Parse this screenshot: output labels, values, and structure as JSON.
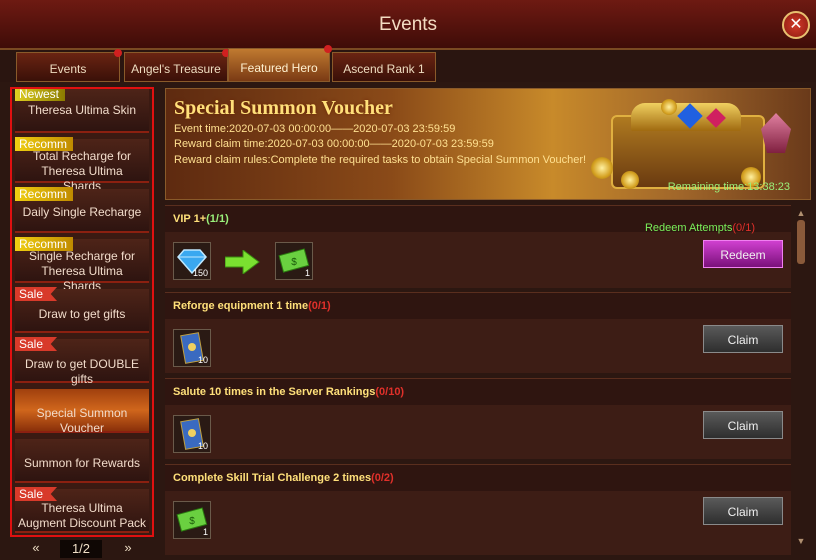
{
  "window": {
    "title": "Events"
  },
  "tabs": [
    {
      "label": "Events",
      "active": false
    },
    {
      "label": "Angel's Treasure",
      "active": false
    },
    {
      "label": "Featured Hero",
      "active": true
    },
    {
      "label": "Ascend Rank 1",
      "active": false
    }
  ],
  "sidebar": {
    "items": [
      {
        "badge": "Newest",
        "label": "Theresa Ultima Skin"
      },
      {
        "badge": "Recomm",
        "label": "Total Recharge for Theresa Ultima Shards"
      },
      {
        "badge": "Recomm",
        "label": "Daily Single Recharge"
      },
      {
        "badge": "Recomm",
        "label": "Single Recharge for Theresa Ultima Shards"
      },
      {
        "badge": "Sale",
        "label": "Draw to get gifts"
      },
      {
        "badge": "Sale",
        "label": "Draw to get DOUBLE gifts"
      },
      {
        "badge": "",
        "label": "Special Summon Voucher",
        "active": true
      },
      {
        "badge": "",
        "label": "Summon for Rewards"
      },
      {
        "badge": "Sale",
        "label": "Theresa Ultima Augment Discount Pack"
      }
    ]
  },
  "pager": {
    "prev": "«",
    "page": "1/2",
    "next": "»"
  },
  "banner": {
    "title": "Special Summon Voucher",
    "event_time": "Event time:2020-07-03 00:00:00——2020-07-03 23:59:59",
    "claim_time": "Reward claim time:2020-07-03 00:00:00——2020-07-03 23:59:59",
    "rules": "Reward claim rules:Complete the required tasks to obtain Special Summon Voucher!",
    "remaining": "Remaining time:13:38:23"
  },
  "tasks": [
    {
      "title": "VIP 1+",
      "progress": "(1/1)",
      "done": true,
      "attempts_label": "Redeem Attempts",
      "attempts": "(0/1)",
      "button": "Redeem"
    },
    {
      "title": "Reforge equipment 1 time",
      "progress": "(0/1)",
      "button": "Claim"
    },
    {
      "title": "Salute 10 times in the Server Rankings",
      "progress": "(0/10)",
      "button": "Claim"
    },
    {
      "title": "Complete Skill Trial Challenge 2 times",
      "progress": "(0/2)",
      "button": "Claim"
    }
  ],
  "items": {
    "diamond_qty": "150",
    "voucher_qty": "1",
    "scroll_qty": "10"
  },
  "colors": {
    "highlight_border": "#e01010",
    "title_gold": "#ffe07a",
    "progress_red": "#e0302a",
    "progress_green": "#9af07a",
    "redeem_purple": "#b020b0"
  },
  "icons": [
    "close-icon",
    "diamond-icon",
    "arrow-right-icon",
    "voucher-icon",
    "scroll-icon",
    "chevron-up-icon",
    "chevron-down-icon"
  ]
}
